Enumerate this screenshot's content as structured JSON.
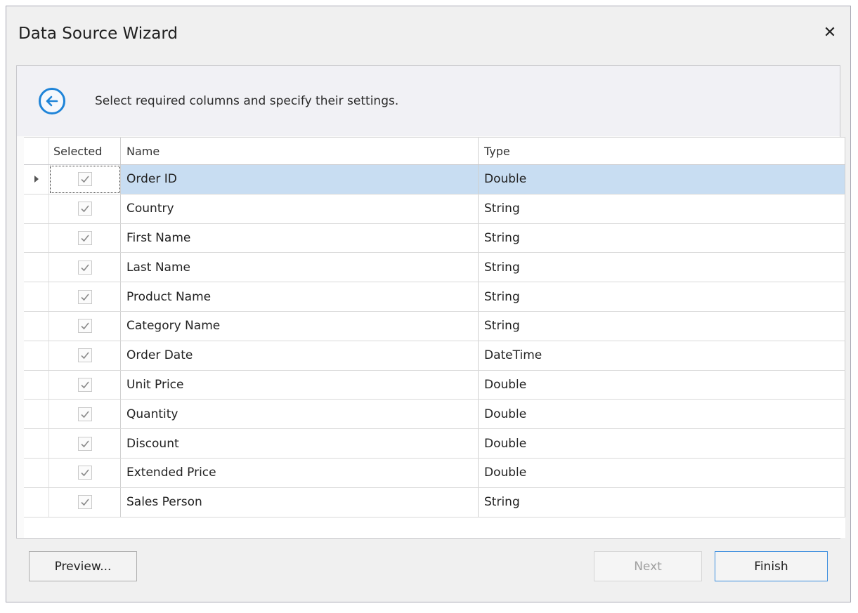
{
  "window": {
    "title": "Data Source Wizard",
    "close_icon": "close-icon"
  },
  "header": {
    "back_icon": "arrow-left-circle-icon",
    "instruction": "Select required columns and specify their settings."
  },
  "grid": {
    "columns": {
      "selected": "Selected",
      "name": "Name",
      "type": "Type"
    },
    "rows": [
      {
        "name": "Order ID",
        "type": "Double",
        "selected": true
      },
      {
        "name": "Country",
        "type": "String",
        "selected": true
      },
      {
        "name": "First Name",
        "type": "String",
        "selected": true
      },
      {
        "name": "Last Name",
        "type": "String",
        "selected": true
      },
      {
        "name": "Product Name",
        "type": "String",
        "selected": true
      },
      {
        "name": "Category Name",
        "type": "String",
        "selected": true
      },
      {
        "name": "Order Date",
        "type": "DateTime",
        "selected": true
      },
      {
        "name": "Unit Price",
        "type": "Double",
        "selected": true
      },
      {
        "name": "Quantity",
        "type": "Double",
        "selected": true
      },
      {
        "name": "Discount",
        "type": "Double",
        "selected": true
      },
      {
        "name": "Extended Price",
        "type": "Double",
        "selected": true
      },
      {
        "name": "Sales Person",
        "type": "String",
        "selected": true
      }
    ],
    "focused_row": 0
  },
  "footer": {
    "preview_label": "Preview...",
    "next_label": "Next",
    "finish_label": "Finish"
  },
  "colors": {
    "accent": "#1f84d8",
    "selected_row": "#c8ddf2"
  }
}
